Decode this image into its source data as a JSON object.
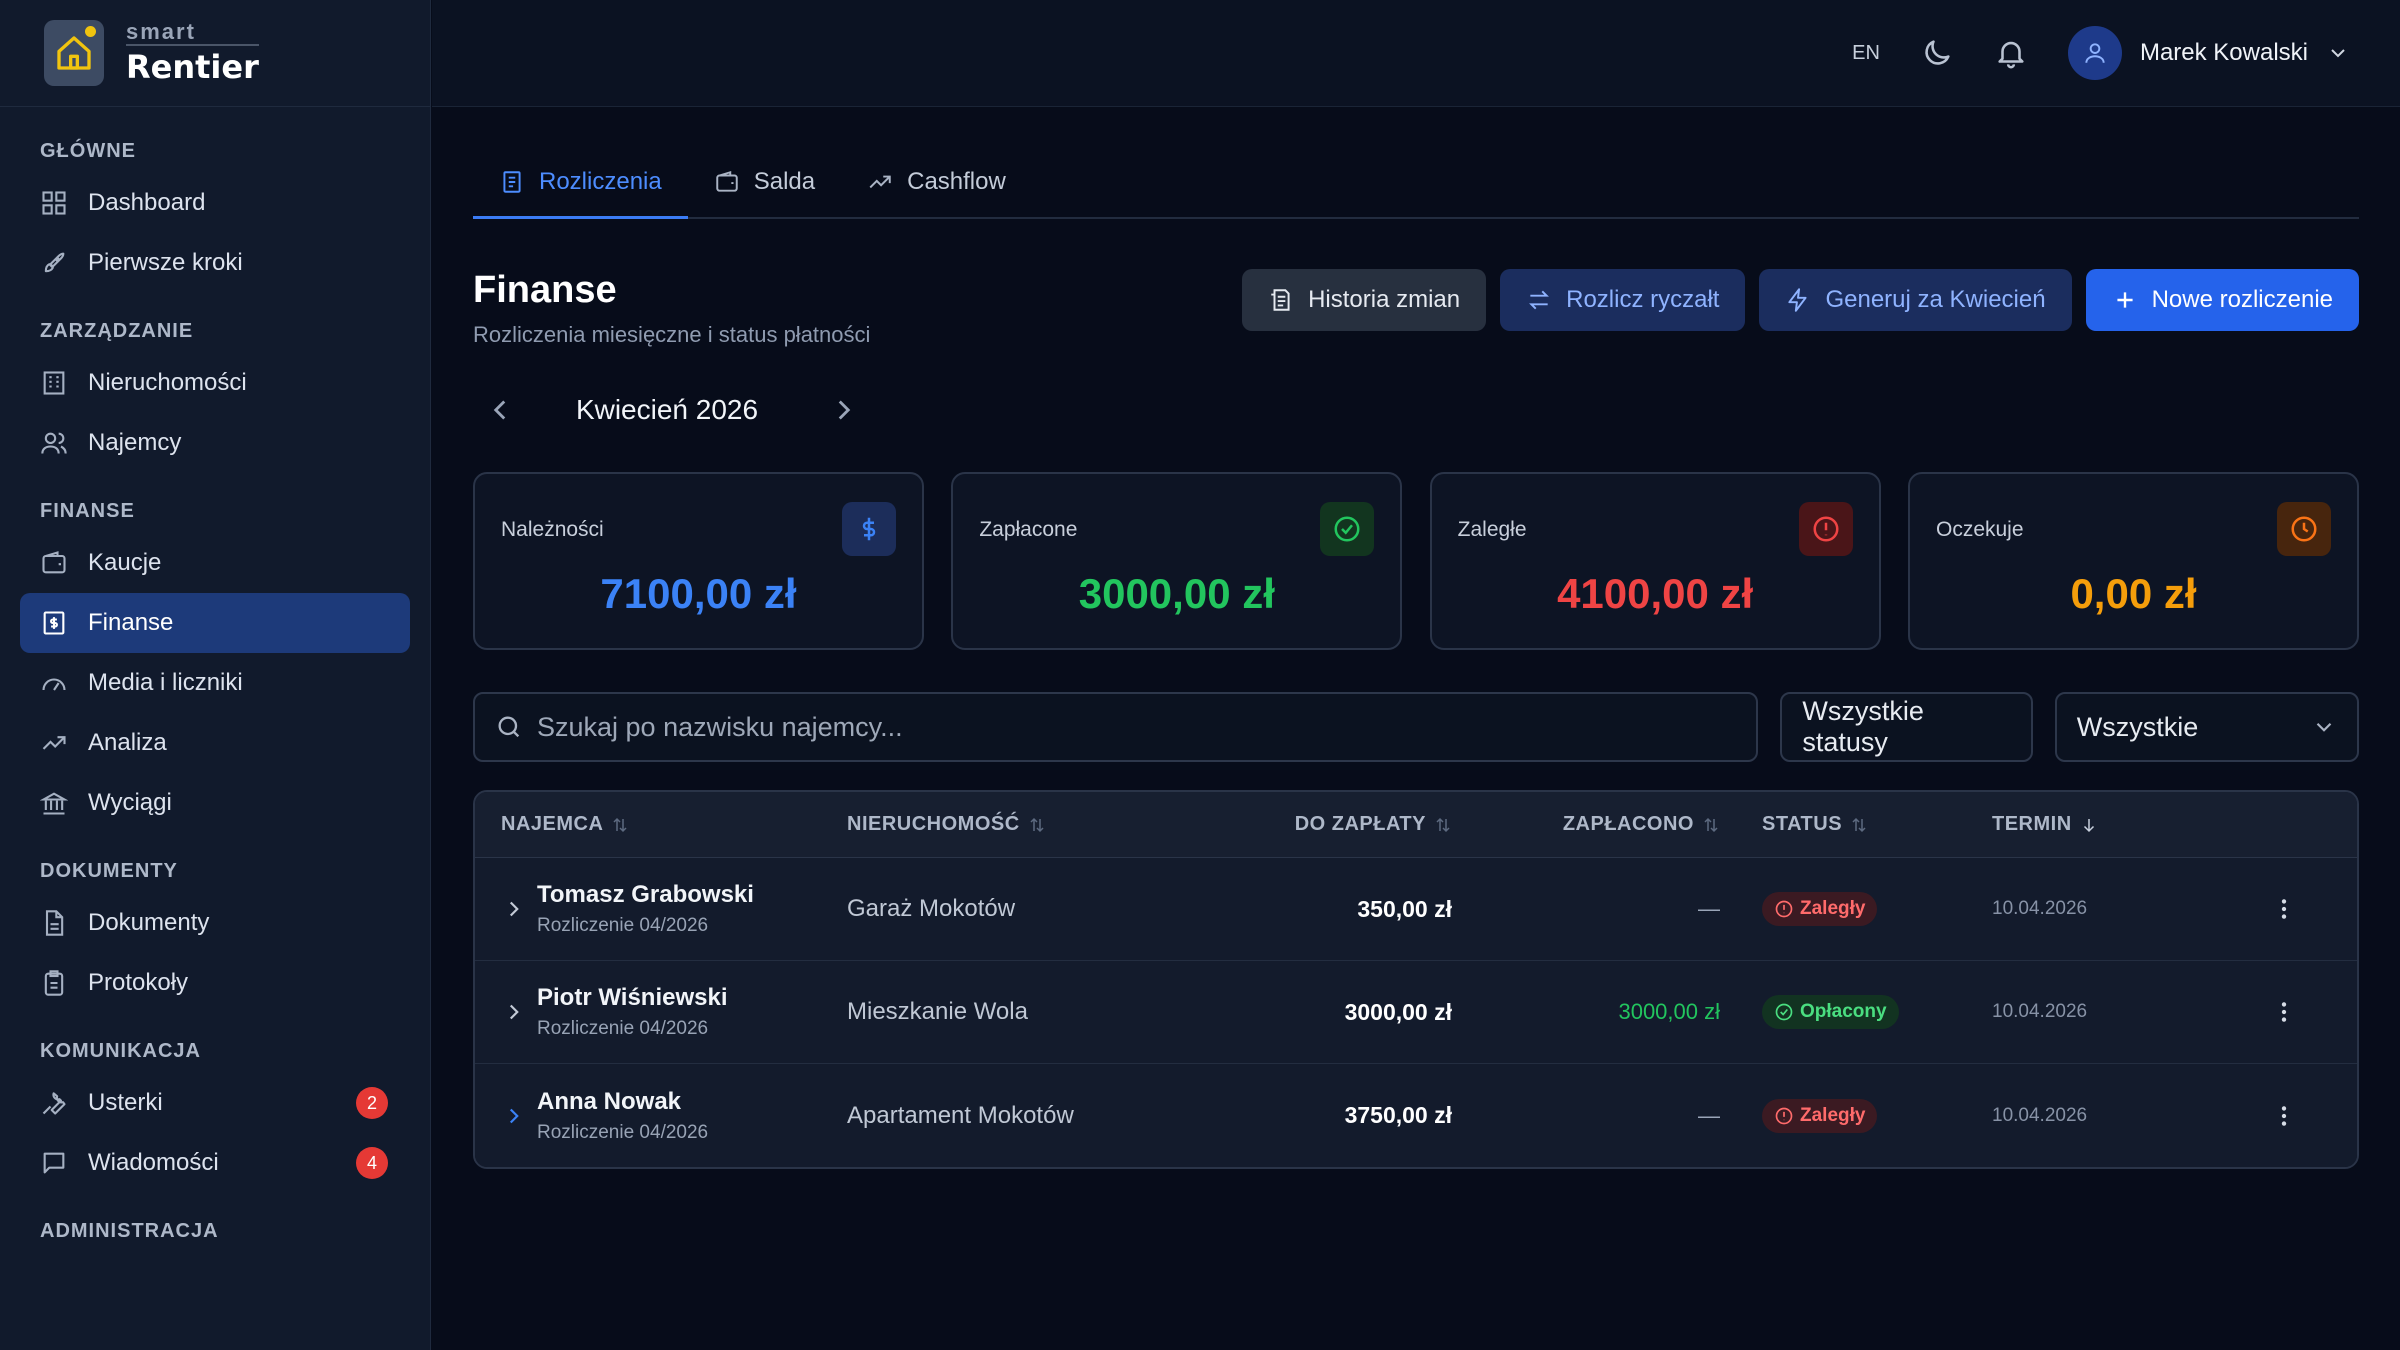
{
  "brand": {
    "small": "smart",
    "big": "Rentier"
  },
  "topbar": {
    "lang": "EN",
    "user_name": "Marek Kowalski"
  },
  "sidebar": {
    "sections": [
      {
        "title": "GŁÓWNE",
        "items": [
          {
            "label": "Dashboard"
          },
          {
            "label": "Pierwsze kroki"
          }
        ]
      },
      {
        "title": "ZARZĄDZANIE",
        "items": [
          {
            "label": "Nieruchomości"
          },
          {
            "label": "Najemcy"
          }
        ]
      },
      {
        "title": "FINANSE",
        "items": [
          {
            "label": "Kaucje"
          },
          {
            "label": "Finanse"
          },
          {
            "label": "Media i liczniki"
          },
          {
            "label": "Analiza"
          },
          {
            "label": "Wyciągi"
          }
        ]
      },
      {
        "title": "DOKUMENTY",
        "items": [
          {
            "label": "Dokumenty"
          },
          {
            "label": "Protokoły"
          }
        ]
      },
      {
        "title": "KOMUNIKACJA",
        "items": [
          {
            "label": "Usterki",
            "badge": "2"
          },
          {
            "label": "Wiadomości",
            "badge": "4"
          }
        ]
      },
      {
        "title": "ADMINISTRACJA",
        "items": []
      }
    ]
  },
  "tabs": [
    {
      "label": "Rozliczenia"
    },
    {
      "label": "Salda"
    },
    {
      "label": "Cashflow"
    }
  ],
  "page": {
    "title": "Finanse",
    "subtitle": "Rozliczenia miesięczne i status płatności"
  },
  "actions": {
    "history": "Historia zmian",
    "settle_flat": "Rozlicz ryczałt",
    "generate": "Generuj za Kwiecień",
    "new": "Nowe rozliczenie"
  },
  "month": {
    "label": "Kwiecień 2026"
  },
  "cards": [
    {
      "label": "Należności",
      "value": "7100,00 zł",
      "color": "#3b82f6"
    },
    {
      "label": "Zapłacone",
      "value": "3000,00 zł",
      "color": "#22c55e"
    },
    {
      "label": "Zaległe",
      "value": "4100,00 zł",
      "color": "#ef4444"
    },
    {
      "label": "Oczekuje",
      "value": "0,00 zł",
      "color": "#f59e0b"
    }
  ],
  "filters": {
    "search_placeholder": "Szukaj po nazwisku najemcy...",
    "status_select": "Wszystkie statusy",
    "all_select": "Wszystkie"
  },
  "table": {
    "headers": {
      "tenant": "NAJEMCA",
      "property": "NIERUCHOMOŚĆ",
      "due": "DO ZAPŁATY",
      "paid": "ZAPŁACONO",
      "status": "STATUS",
      "term": "TERMIN"
    },
    "rows": [
      {
        "tenant": "Tomasz Grabowski",
        "sub": "Rozliczenie 04/2026",
        "property": "Garaż Mokotów",
        "due": "350,00 zł",
        "paid": "—",
        "status": "Zaległy",
        "date": "10.04.2026"
      },
      {
        "tenant": "Piotr Wiśniewski",
        "sub": "Rozliczenie 04/2026",
        "property": "Mieszkanie Wola",
        "due": "3000,00 zł",
        "paid": "3000,00 zł",
        "status": "Opłacony",
        "date": "10.04.2026"
      },
      {
        "tenant": "Anna Nowak",
        "sub": "Rozliczenie 04/2026",
        "property": "Apartament Mokotów",
        "due": "3750,00 zł",
        "paid": "—",
        "status": "Zaległy",
        "date": "10.04.2026"
      }
    ]
  }
}
